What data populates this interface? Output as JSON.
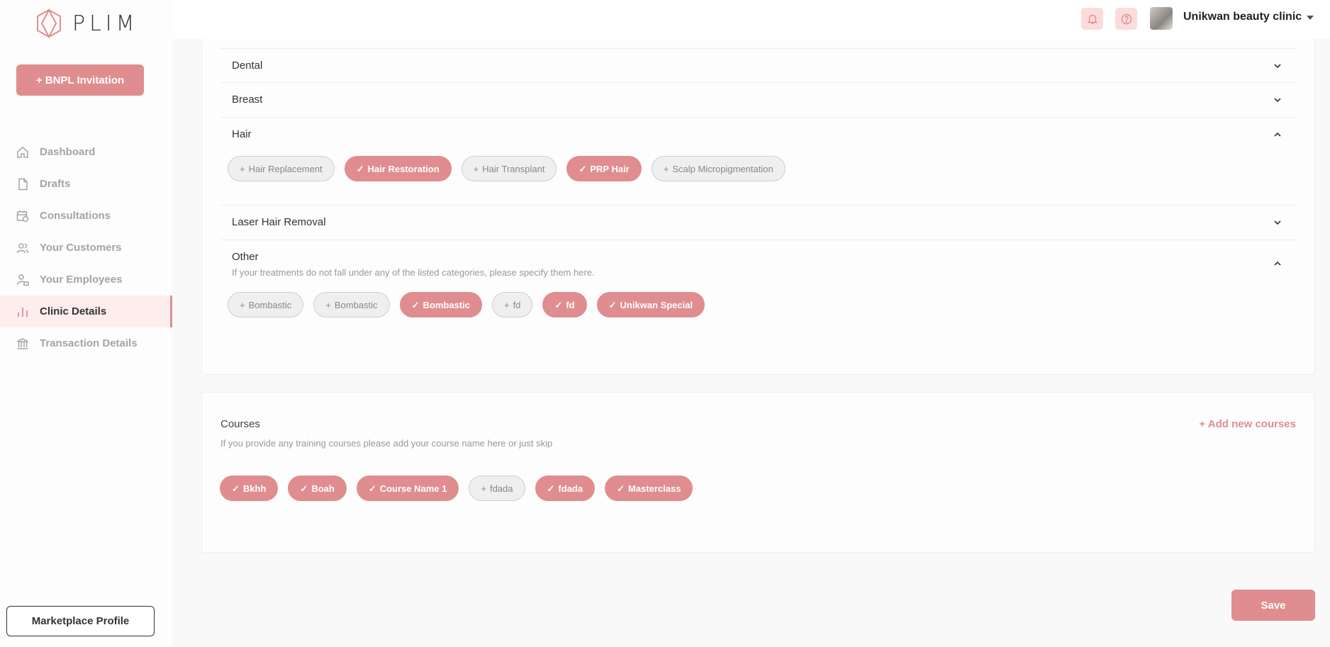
{
  "brand": {
    "name": "PLIM",
    "accent": "#e08d8f"
  },
  "sidebar": {
    "bnpl_label": "+ BNPL Invitation",
    "items": [
      {
        "label": "Dashboard",
        "icon": "home-icon",
        "active": false
      },
      {
        "label": "Drafts",
        "icon": "file-icon",
        "active": false
      },
      {
        "label": "Consultations",
        "icon": "calendar-clock-icon",
        "active": false
      },
      {
        "label": "Your Customers",
        "icon": "users-icon",
        "active": false
      },
      {
        "label": "Your Employees",
        "icon": "employee-icon",
        "active": false
      },
      {
        "label": "Clinic Details",
        "icon": "bar-chart-icon",
        "active": true
      },
      {
        "label": "Transaction Details",
        "icon": "bank-icon",
        "active": false
      }
    ],
    "marketplace_label": "Marketplace Profile"
  },
  "header": {
    "clinic_name": "Unikwan beauty clinic",
    "icons": [
      "bell-icon",
      "help-icon"
    ]
  },
  "treatments": {
    "sections": [
      {
        "title": "Dental",
        "expanded": false
      },
      {
        "title": "Breast",
        "expanded": false
      },
      {
        "title": "Hair",
        "expanded": true,
        "chips": [
          {
            "label": "Hair Replacement",
            "selected": false
          },
          {
            "label": "Hair Restoration",
            "selected": true
          },
          {
            "label": "Hair Transplant",
            "selected": false
          },
          {
            "label": "PRP Hair",
            "selected": true
          },
          {
            "label": "Scalp Micropigmentation",
            "selected": false
          }
        ]
      },
      {
        "title": "Laser Hair Removal",
        "expanded": false
      },
      {
        "title": "Other",
        "expanded": true,
        "subtitle": "If your treatments do not fall under any of the listed categories, please specify them here.",
        "chips": [
          {
            "label": "Bombastic",
            "selected": false
          },
          {
            "label": "Bombastic",
            "selected": false
          },
          {
            "label": "Bombastic",
            "selected": true
          },
          {
            "label": "fd",
            "selected": false
          },
          {
            "label": "fd",
            "selected": true
          },
          {
            "label": "Unikwan Special",
            "selected": true
          }
        ]
      }
    ]
  },
  "courses": {
    "title": "Courses",
    "subtitle": "If you provide any training courses please add your course name here or just skip",
    "add_label": "+ Add new courses",
    "chips": [
      {
        "label": "Bkhh",
        "selected": true
      },
      {
        "label": "Boah",
        "selected": true
      },
      {
        "label": "Course Name 1",
        "selected": true
      },
      {
        "label": "fdada",
        "selected": false
      },
      {
        "label": "fdada",
        "selected": true
      },
      {
        "label": "Masterclass",
        "selected": true
      }
    ]
  },
  "save_label": "Save"
}
